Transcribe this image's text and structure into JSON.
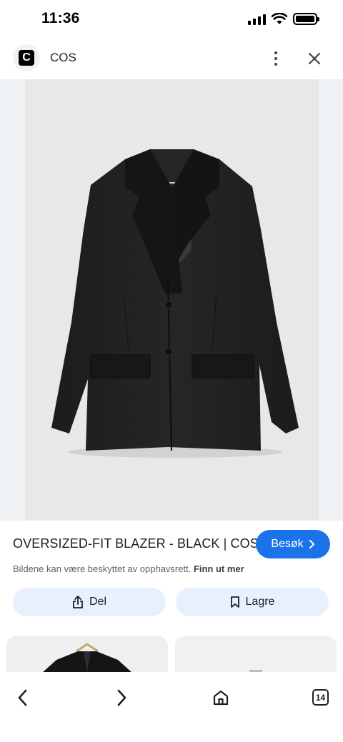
{
  "status_bar": {
    "time": "11:36"
  },
  "header": {
    "site_logo_letter": "C",
    "site_name": "COS"
  },
  "product": {
    "title": "OVERSIZED-FIT BLAZER - BLACK | COS",
    "visit_label": "Besøk",
    "copyright_text": "Bildene kan være beskyttet av opphavsrett.",
    "learn_more": "Finn ut mer"
  },
  "actions": {
    "share_label": "Del",
    "save_label": "Lagre"
  },
  "bottom_nav": {
    "tab_count": "14"
  },
  "colors": {
    "accent": "#1a73e8",
    "chip_bg": "#e8f0fe",
    "image_bg": "#e8e8e8"
  }
}
